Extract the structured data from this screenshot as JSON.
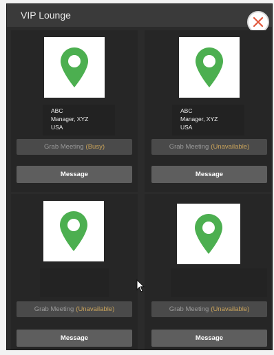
{
  "window": {
    "title": "VIP Lounge"
  },
  "icons": {
    "close": "close-icon",
    "pin": "map-pin-icon"
  },
  "colors": {
    "pin": "#4caf50",
    "status": "#c8a25a",
    "close": "#e0563a"
  },
  "cards": [
    {
      "name_line": "ABC",
      "title_line": "Manager, XYZ",
      "location_line": "USA",
      "grab_label": "Grab Meeting",
      "status": "(Busy)",
      "message_label": "Message"
    },
    {
      "name_line": "ABC",
      "title_line": "Manager, XYZ",
      "location_line": "USA",
      "grab_label": "Grab Meeting",
      "status": "(Unavailable)",
      "message_label": "Message"
    },
    {
      "grab_label": "Grab Meeting",
      "status": "(Unavailable)",
      "message_label": "Message"
    },
    {
      "grab_label": "Grab Meeting",
      "status": "(Unavailable)",
      "message_label": "Message"
    }
  ]
}
